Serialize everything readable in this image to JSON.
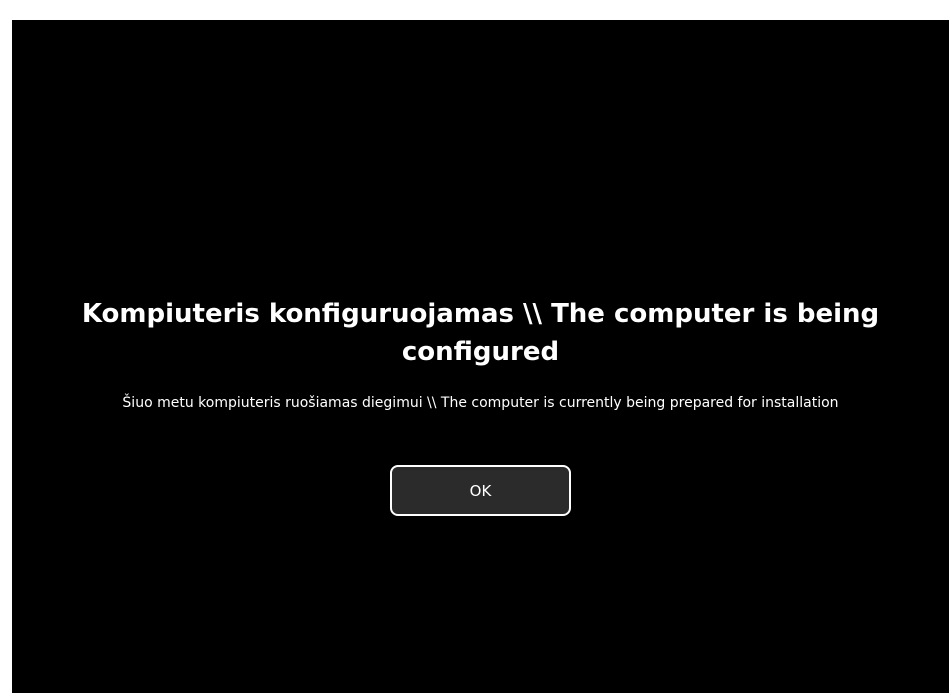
{
  "dialog": {
    "title": "Kompiuteris konfiguruojamas \\\\ The computer is being configured",
    "message": "Šiuo metu kompiuteris ruošiamas diegimui \\\\ The computer is currently being prepared for installation",
    "ok_label": "OK"
  },
  "colors": {
    "background": "#000000",
    "text": "#ffffff",
    "button_background": "#2b2b2b",
    "button_border": "#ffffff"
  }
}
